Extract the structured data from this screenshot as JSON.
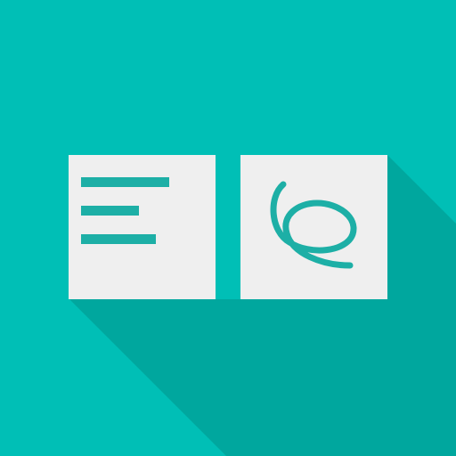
{
  "app_icon": {
    "icons": {
      "text_card": "text-lines-icon",
      "handwriting_card": "handwriting-scribble-icon"
    },
    "colors": {
      "background": "#00BFB6",
      "long_shadow": "#00A79E",
      "card": "#EFEFEF",
      "accent": "#1DAFA6"
    }
  }
}
